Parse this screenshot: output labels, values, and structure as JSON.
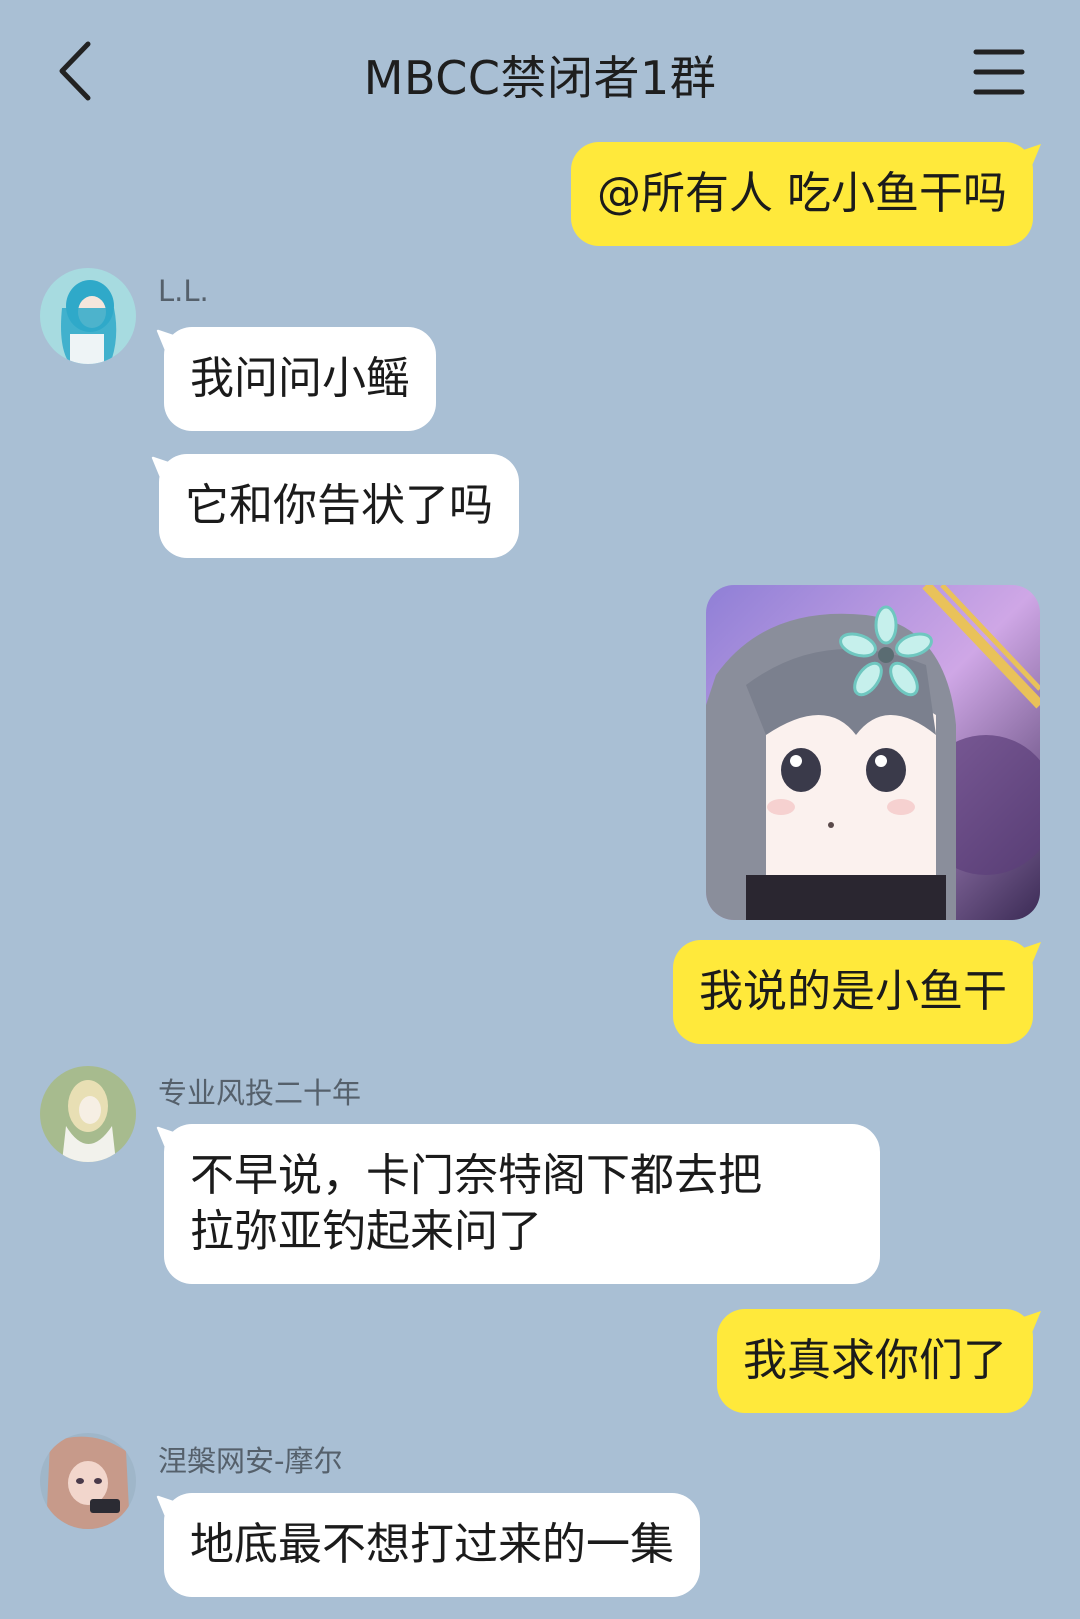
{
  "header": {
    "title": "MBCC禁闭者1群"
  },
  "messages": {
    "m1": {
      "text": "@所有人 吃小鱼干吗"
    },
    "ll": {
      "sender": "L.L.",
      "m2": "我问问小鳐",
      "m3": "它和你告状了吗"
    },
    "m5": {
      "text": "我说的是小鱼干"
    },
    "vc": {
      "sender": "专业风投二十年",
      "line1": "不早说，卡门奈特阁下都去把",
      "line2": "拉弥亚钓起来问了"
    },
    "m7": {
      "text": "我真求你们了"
    },
    "nb": {
      "sender": "涅槃网安-摩尔",
      "m8": "地底最不想打过来的一集"
    }
  },
  "colors": {
    "background": "#a9bfd4",
    "outgoing_bubble": "#ffe93b",
    "incoming_bubble": "#ffffff"
  },
  "icons": {
    "back": "chevron-left-icon",
    "menu": "hamburger-menu-icon"
  }
}
